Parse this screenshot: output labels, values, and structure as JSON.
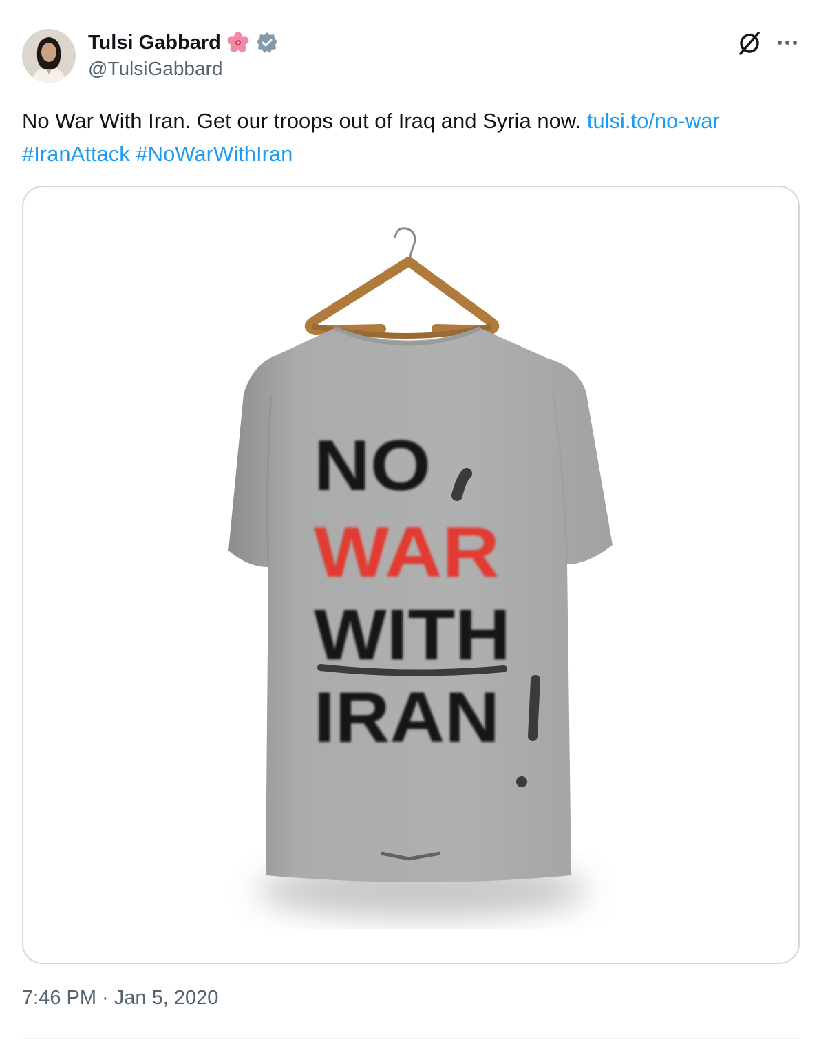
{
  "author": {
    "name": "Tulsi Gabbard",
    "handle": "@TulsiGabbard",
    "badge_icons": [
      "hibiscus-flower-emoji",
      "verified-badge-icon"
    ],
    "avatar_icon": "profile-photo"
  },
  "header_icons": [
    "grok-icon",
    "more-options-icon"
  ],
  "tweet": {
    "text_plain": "No War With Iran. Get our troops out of Iraq and Syria now. ",
    "link": "tulsi.to/no-war",
    "hashtags": [
      "#IranAttack",
      "#NoWarWithIran"
    ]
  },
  "media": {
    "shirt_text": {
      "line1": "NO",
      "line2": "WAR",
      "line3": "WITH",
      "line4": "IRAN"
    },
    "added_mark": "!"
  },
  "timestamp": "7:46 PM · Jan 5, 2020",
  "colors": {
    "link": "#1d9bf0",
    "text": "#0f1419",
    "muted": "#536471",
    "shirt": "#a9a9a9",
    "print_red": "#e23b32",
    "print_black": "#161616",
    "verified": "#829aab"
  }
}
